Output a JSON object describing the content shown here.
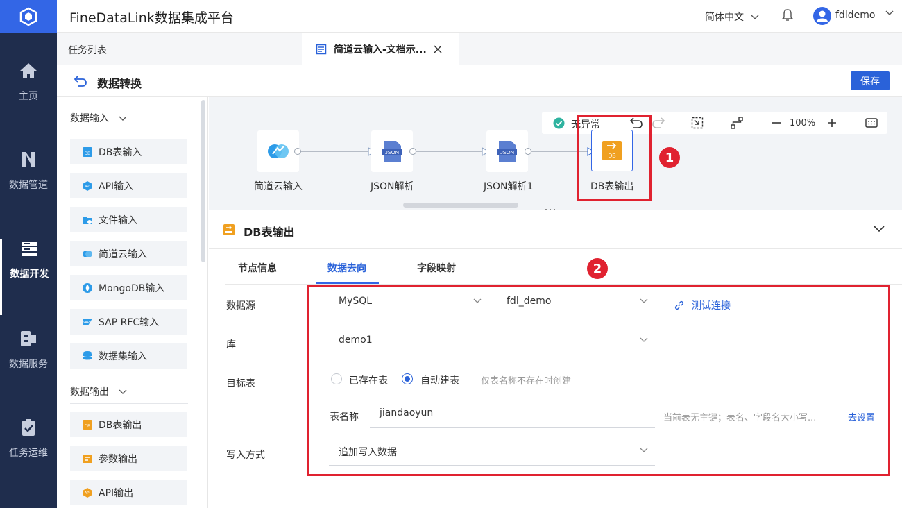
{
  "colors": {
    "accent": "#2a62d9",
    "nav_bg": "#1f2d4d",
    "highlight_red": "#e02230",
    "db_orange": "#f0a020"
  },
  "header": {
    "app_title": "FineDataLink数据集成平台",
    "language": "简体中文",
    "username": "fdldemo"
  },
  "sidebar": {
    "items": [
      {
        "label": "主页",
        "icon": "home-icon"
      },
      {
        "label": "数据管道",
        "icon": "pipeline-icon"
      },
      {
        "label": "数据开发",
        "icon": "dev-icon",
        "active": true
      },
      {
        "label": "数据服务",
        "icon": "service-icon"
      },
      {
        "label": "任务运维",
        "icon": "ops-icon"
      }
    ]
  },
  "tabs": {
    "task_list": "任务列表",
    "current": "简道云输入-文档示..."
  },
  "titlebar": {
    "title": "数据转换",
    "save_label": "保存"
  },
  "palette": {
    "input_group": "数据输入",
    "inputs": [
      "DB表输入",
      "API输入",
      "文件输入",
      "简道云输入",
      "MongoDB输入",
      "SAP RFC输入",
      "数据集输入"
    ],
    "output_group": "数据输出",
    "outputs": [
      "DB表输出",
      "参数输出",
      "API输出"
    ]
  },
  "canvas": {
    "status": "无异常",
    "zoom": "100%",
    "nodes": [
      {
        "label": "简道云输入",
        "icon": "jiandaoyun-icon"
      },
      {
        "label": "JSON解析",
        "icon": "json-icon"
      },
      {
        "label": "JSON解析1",
        "icon": "json-icon"
      },
      {
        "label": "DB表输出",
        "icon": "db-icon",
        "selected": true
      }
    ],
    "json_badge": "JSON",
    "db_badge": "DB"
  },
  "panel": {
    "title": "DB表输出",
    "tabs": [
      "节点信息",
      "数据去向",
      "字段映射"
    ],
    "active_tab": "数据去向",
    "datasource_label": "数据源",
    "datasource_type": "MySQL",
    "datasource_conn": "fdl_demo",
    "test_conn": "测试连接",
    "db_label": "库",
    "db_value": "demo1",
    "target_label": "目标表",
    "radio_existing": "已存在表",
    "radio_auto": "自动建表",
    "auto_hint": "仅表名称不存在时创建",
    "tablename_label": "表名称",
    "tablename_value": "jiandaoyun",
    "pk_hint": "当前表无主键；表名、字段名大小写...",
    "go_settings": "去设置",
    "write_label": "写入方式",
    "write_value": "追加写入数据"
  },
  "annotations": [
    "1",
    "2"
  ]
}
